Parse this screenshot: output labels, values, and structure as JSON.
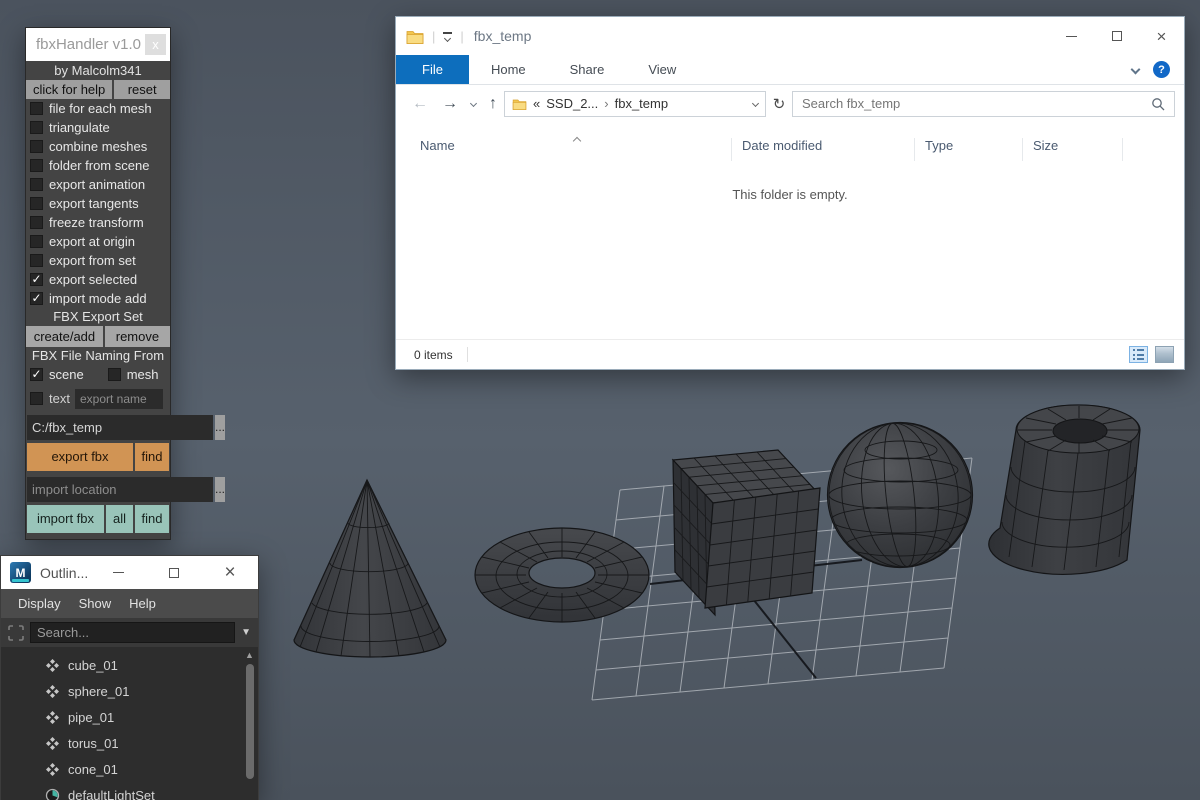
{
  "icons": {
    "refresh": "↻",
    "back_arrow": "←",
    "forward_arrow": "→",
    "up_arrow": "↑",
    "help": "?",
    "close": "×",
    "maya_m": "M",
    "dropdown_caret": "▼",
    "scroll_up": "▲"
  },
  "theme": {
    "viewport_bg": "#525c67",
    "file_tab_blue": "#0d6ebd",
    "export_orange": "#d19454",
    "import_teal": "#99c4b9",
    "panel_gray": "#444444",
    "outliner_bg": "#2d2d2d"
  },
  "viewport": {
    "objects": [
      "cone",
      "torus",
      "cube",
      "sphere",
      "pipe"
    ]
  },
  "fbx_handler": {
    "title": "fbxHandler v1.0",
    "close_label": "x",
    "byline": "by Malcolm341",
    "help_button": "click for help",
    "reset_button": "reset",
    "checkboxes": [
      {
        "label": "file for each mesh",
        "checked": false
      },
      {
        "label": "triangulate",
        "checked": false
      },
      {
        "label": "combine meshes",
        "checked": false
      },
      {
        "label": "folder from scene",
        "checked": false
      },
      {
        "label": "export animation",
        "checked": false
      },
      {
        "label": "export tangents",
        "checked": false
      },
      {
        "label": "freeze transform",
        "checked": false
      },
      {
        "label": "export at origin",
        "checked": false
      },
      {
        "label": "export from set",
        "checked": false
      },
      {
        "label": "export selected",
        "checked": true
      },
      {
        "label": "import mode add",
        "checked": true
      }
    ],
    "export_set_label": "FBX Export Set",
    "create_add_button": "create/add",
    "remove_button": "remove",
    "naming_label": "FBX File Naming From",
    "scene_checkbox": {
      "label": "scene",
      "checked": true
    },
    "mesh_checkbox": {
      "label": "mesh",
      "checked": false
    },
    "text_checkbox": {
      "label": "text",
      "checked": false
    },
    "export_name_placeholder": "export name",
    "export_path_value": "C:/fbx_temp",
    "browse_button": "...",
    "export_fbx_button": "export fbx",
    "export_find_button": "find",
    "import_location_placeholder": "import location",
    "import_fbx_button": "import fbx",
    "import_all_button": "all",
    "import_find_button": "find"
  },
  "explorer": {
    "title": "fbx_temp",
    "tabs": [
      "File",
      "Home",
      "Share",
      "View"
    ],
    "address": {
      "prefix": "«",
      "drive": "SSD_2...",
      "separator": "›",
      "current": "fbx_temp"
    },
    "search_placeholder": "Search fbx_temp",
    "columns": {
      "name": "Name",
      "date_modified": "Date modified",
      "type": "Type",
      "size": "Size"
    },
    "empty_message": "This folder is empty.",
    "status_items": "0 items"
  },
  "outliner": {
    "title": "Outlin...",
    "menus": [
      "Display",
      "Show",
      "Help"
    ],
    "search_placeholder": "Search...",
    "items": [
      {
        "label": "cube_01",
        "icon": "transform-node"
      },
      {
        "label": "sphere_01",
        "icon": "transform-node"
      },
      {
        "label": "pipe_01",
        "icon": "transform-node"
      },
      {
        "label": "torus_01",
        "icon": "transform-node"
      },
      {
        "label": "cone_01",
        "icon": "transform-node"
      },
      {
        "label": "defaultLightSet",
        "icon": "light-set"
      }
    ]
  }
}
